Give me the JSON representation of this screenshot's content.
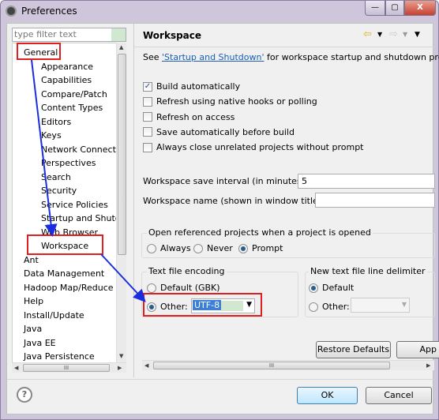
{
  "window": {
    "title": "Preferences",
    "minimize": "—",
    "maximize": "▢",
    "close": "X"
  },
  "sidebar": {
    "filter_placeholder": "type filter text",
    "items": [
      {
        "label": "General",
        "level": 0
      },
      {
        "label": "Appearance",
        "level": 1
      },
      {
        "label": "Capabilities",
        "level": 1
      },
      {
        "label": "Compare/Patch",
        "level": 1
      },
      {
        "label": "Content Types",
        "level": 1
      },
      {
        "label": "Editors",
        "level": 1
      },
      {
        "label": "Keys",
        "level": 1
      },
      {
        "label": "Network Connecti",
        "level": 1
      },
      {
        "label": "Perspectives",
        "level": 1
      },
      {
        "label": "Search",
        "level": 1
      },
      {
        "label": "Security",
        "level": 1
      },
      {
        "label": "Service Policies",
        "level": 1
      },
      {
        "label": "Startup and Shutd",
        "level": 1
      },
      {
        "label": "Web Browser",
        "level": 1
      },
      {
        "label": "Workspace",
        "level": 1
      },
      {
        "label": "Ant",
        "level": 0
      },
      {
        "label": "Data Management",
        "level": 0
      },
      {
        "label": "Hadoop Map/Reduce",
        "level": 0
      },
      {
        "label": "Help",
        "level": 0
      },
      {
        "label": "Install/Update",
        "level": 0
      },
      {
        "label": "Java",
        "level": 0
      },
      {
        "label": "Java EE",
        "level": 0
      },
      {
        "label": "Java Persistence",
        "level": 0
      }
    ],
    "scroll_grip": "III"
  },
  "main": {
    "title": "Workspace",
    "intro_prefix": "See ",
    "intro_link": "'Startup and Shutdown'",
    "intro_suffix": " for workspace startup and shutdown prefer",
    "checkboxes": [
      {
        "label": "Build automatically",
        "checked": true
      },
      {
        "label": "Refresh using native hooks or polling",
        "checked": false
      },
      {
        "label": "Refresh on access",
        "checked": false
      },
      {
        "label": "Save automatically before build",
        "checked": false
      },
      {
        "label": "Always close unrelated projects without prompt",
        "checked": false
      }
    ],
    "save_interval_label": "Workspace save interval (in minutes):",
    "save_interval_value": "5",
    "workspace_name_label": "Workspace name (shown in window title):",
    "workspace_name_value": "",
    "open_ref": {
      "label": "Open referenced projects when a project is opened",
      "options": [
        "Always",
        "Never",
        "Prompt"
      ],
      "selected": "Prompt"
    },
    "encoding": {
      "label": "Text file encoding",
      "default_label": "Default (GBK)",
      "other_label": "Other:",
      "other_value": "UTF-8",
      "selected": "Other"
    },
    "delimiter": {
      "label": "New text file line delimiter",
      "default_label": "Default",
      "other_label": "Other:",
      "selected": "Default"
    },
    "restore_defaults": "Restore Defaults",
    "apply": "App",
    "scroll_grip": "III"
  },
  "footer": {
    "help": "?",
    "ok": "OK",
    "cancel": "Cancel"
  },
  "annotation_color": "#e02020",
  "arrow_color": "#1a2ee0"
}
